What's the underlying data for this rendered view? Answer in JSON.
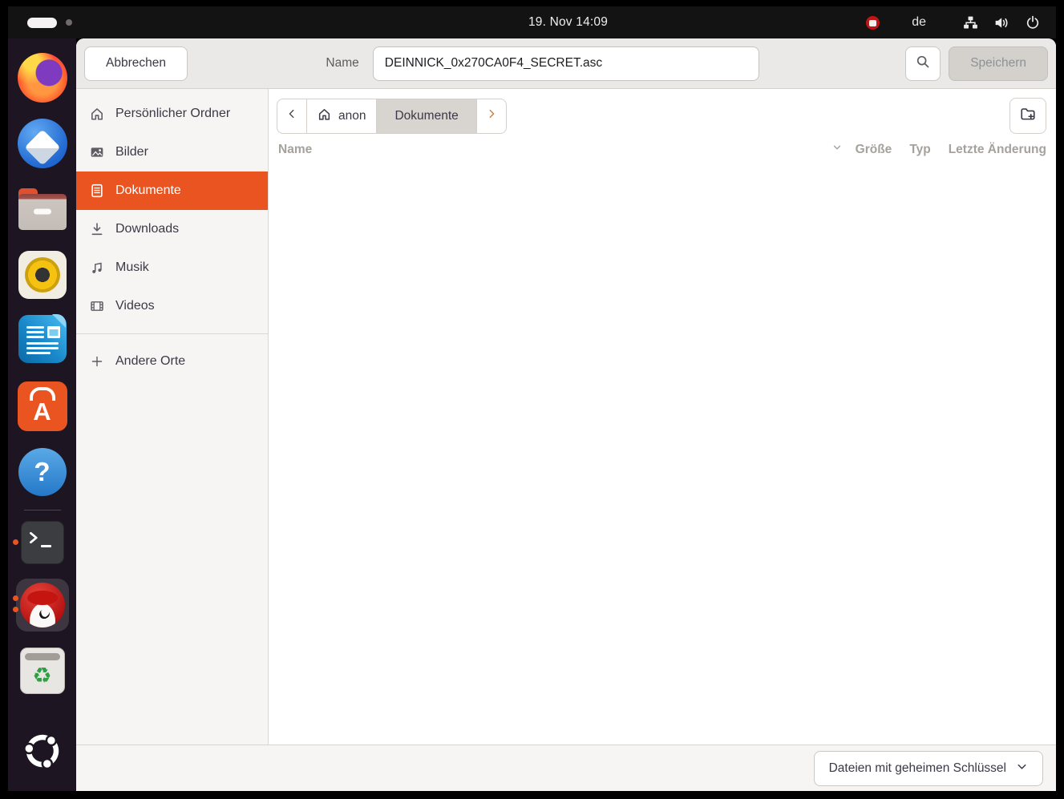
{
  "topbar": {
    "clock": "19. Nov 14:09",
    "keyboard_layout": "de"
  },
  "dock": {
    "apps": [
      "firefox",
      "thunderbird",
      "files",
      "rhythmbox",
      "libreoffice-writer",
      "ubuntu-software",
      "help",
      "terminal",
      "kleopatra",
      "trash",
      "ubuntu-desktop"
    ]
  },
  "icons": {
    "software_glyph": "A",
    "help_glyph": "?",
    "recycle_glyph": "♻"
  },
  "dialog": {
    "header": {
      "cancel_label": "Abbrechen",
      "name_label": "Name",
      "filename": "DEINNICK_0x270CA0F4_SECRET.asc",
      "save_label": "Speichern"
    },
    "sidebar": {
      "items": [
        {
          "label": "Persönlicher Ordner",
          "icon": "home-icon",
          "selected": false
        },
        {
          "label": "Bilder",
          "icon": "image-icon",
          "selected": false
        },
        {
          "label": "Dokumente",
          "icon": "document-icon",
          "selected": true
        },
        {
          "label": "Downloads",
          "icon": "download-icon",
          "selected": false
        },
        {
          "label": "Musik",
          "icon": "music-icon",
          "selected": false
        },
        {
          "label": "Videos",
          "icon": "video-icon",
          "selected": false
        }
      ],
      "other_locations_label": "Andere Orte"
    },
    "pathbar": {
      "home_label": "anon",
      "current_folder": "Dokumente"
    },
    "list": {
      "columns": {
        "name": "Name",
        "size": "Größe",
        "type": "Typ",
        "modified": "Letzte Änderung"
      },
      "rows": []
    },
    "filter_label": "Dateien mit geheimen Schlüssel"
  },
  "colors": {
    "accent": "#E95420",
    "topbar_bg": "#131313",
    "dock_bg": "#1e1522",
    "header_bg": "#ebe9e7",
    "sidebar_bg": "#f6f5f4",
    "selected_row": "#E95420"
  }
}
